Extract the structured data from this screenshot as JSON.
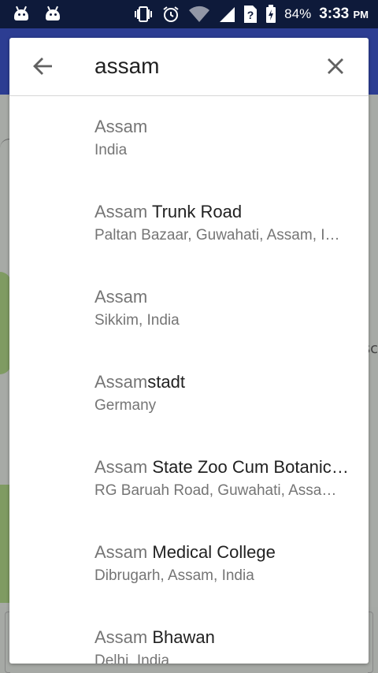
{
  "status_bar": {
    "battery": "84%",
    "time": "3:33",
    "ampm": "PM",
    "icons": [
      "android-icon",
      "android-icon",
      "vibrate-icon",
      "alarm-icon",
      "wifi-icon",
      "signal-icon",
      "unknown-sim-icon",
      "battery-charging-icon"
    ]
  },
  "search": {
    "query": "assam",
    "back_icon": "arrow-left-icon",
    "clear_icon": "close-icon"
  },
  "results": [
    {
      "match": "Assam",
      "rest": "",
      "subtitle": "India"
    },
    {
      "match": "Assam",
      "rest": " Trunk Road",
      "subtitle": "Paltan Bazaar, Guwahati, Assam, India"
    },
    {
      "match": "Assam",
      "rest": "",
      "subtitle": "Sikkim, India"
    },
    {
      "match": "Assam",
      "rest": "stadt",
      "subtitle": "Germany"
    },
    {
      "match": "Assam",
      "rest": " State Zoo Cum Botanical Garden",
      "subtitle": "RG Baruah Road, Guwahati, Assam, India"
    },
    {
      "match": "Assam",
      "rest": " Medical College",
      "subtitle": "Dibrugarh, Assam, India"
    },
    {
      "match": "Assam",
      "rest": " Bhawan",
      "subtitle": "Delhi, India"
    }
  ],
  "map": {
    "edge_text": "sc"
  },
  "colors": {
    "status_bar": "#0e1a3a",
    "app_bar": "#2c3d92",
    "match_text": "#757575",
    "primary_text": "#212121"
  }
}
